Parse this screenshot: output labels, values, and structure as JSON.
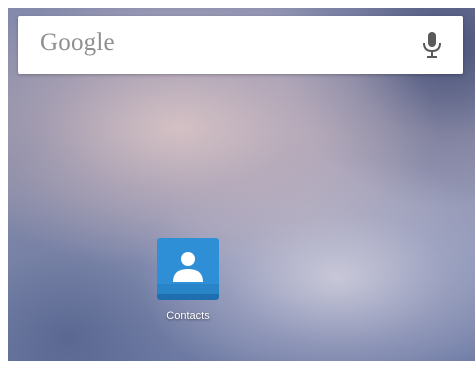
{
  "search": {
    "placeholder": "Google",
    "voice_icon": "mic-icon"
  },
  "home": {
    "apps": [
      {
        "label": "Contacts",
        "icon": "contacts-icon",
        "color": "#2f8fd6"
      }
    ]
  },
  "colors": {
    "search_bg": "#ffffff",
    "placeholder_text": "#8f8f8f",
    "mic": "#5a5a5a",
    "app_label": "#ffffff"
  }
}
